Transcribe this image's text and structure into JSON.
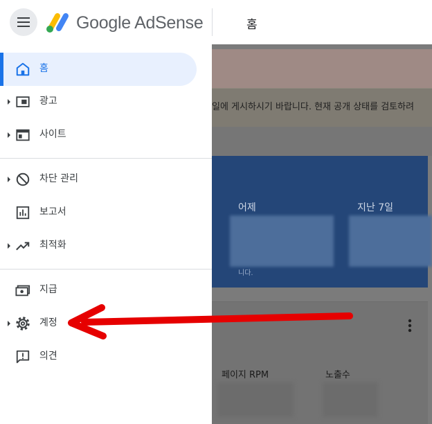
{
  "header": {
    "brand": "Google AdSense",
    "page_title": "홈",
    "icons": {
      "menu": "hamburger-menu-icon",
      "logo": "adsense-logo-icon"
    }
  },
  "sidebar": {
    "items": [
      {
        "label": "홈",
        "icon": "home-icon",
        "expandable": false,
        "selected": true
      },
      {
        "label": "광고",
        "icon": "ads-icon",
        "expandable": true
      },
      {
        "label": "사이트",
        "icon": "sites-icon",
        "expandable": true
      },
      {
        "label": "차단 관리",
        "icon": "block-icon",
        "expandable": true
      },
      {
        "label": "보고서",
        "icon": "reports-icon",
        "expandable": false
      },
      {
        "label": "최적화",
        "icon": "optimization-icon",
        "expandable": true
      },
      {
        "label": "지급",
        "icon": "payments-icon",
        "expandable": false
      },
      {
        "label": "계정",
        "icon": "gear-icon",
        "expandable": true
      },
      {
        "label": "의견",
        "icon": "feedback-icon",
        "expandable": false
      }
    ]
  },
  "main": {
    "notice_text": "일에 게시하시기 바랍니다. 현재 공개 상태를 검토하려",
    "earnings": {
      "yesterday_label": "어제",
      "last7_label": "지난 7일",
      "note": "니다."
    },
    "card2": {
      "rpm_label": "페이지 RPM",
      "impressions_label": "노출수"
    }
  },
  "colors": {
    "accent": "#1a73e8",
    "selected_bg": "#e8f0fe",
    "annotation_arrow": "#e60000",
    "overlay": "#7b7b7b",
    "earnings_card": "#244678"
  }
}
